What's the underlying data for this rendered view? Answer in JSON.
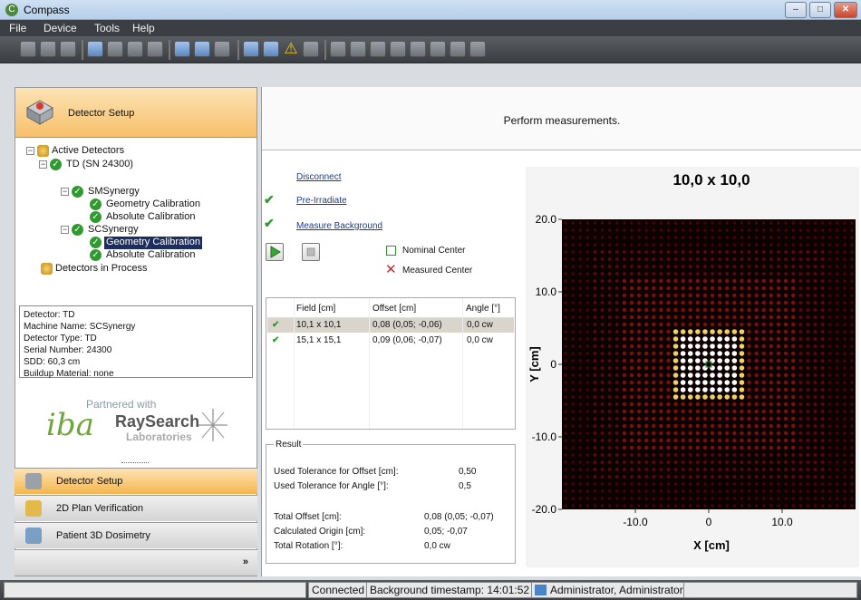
{
  "window": {
    "title": "Compass",
    "min": "–",
    "max": "□",
    "close": "✕"
  },
  "menu": [
    "File",
    "Device",
    "Tools",
    "Help"
  ],
  "left": {
    "header_label": "Detector Setup",
    "tree": {
      "active_detectors": "Active Detectors",
      "td": "TD (SN 24300)",
      "smsynergy": "SMSynergy",
      "sm_geom": "Geometry Calibration",
      "sm_abs": "Absolute Calibration",
      "scsynergy": "SCSynergy",
      "sc_geom": "Geometry Calibration",
      "sc_abs": "Absolute Calibration",
      "in_process": "Detectors in Process"
    },
    "info": [
      "Detector: TD",
      "Machine Name: SCSynergy",
      "Detector Type: TD",
      "Serial Number: 24300",
      "SDD: 60,3 cm",
      "Buildup Material: none"
    ],
    "partner": {
      "caption": "Partnered with",
      "iba": "iba",
      "ray": "RaySearch",
      "lab": "Laboratories"
    },
    "nav": [
      "Detector Setup",
      "2D Plan Verification",
      "Patient 3D Dosimetry"
    ],
    "more": "»"
  },
  "main": {
    "banner": "Perform measurements.",
    "actions": {
      "disconnect": "Disconnect",
      "preirradiate": "Pre-Irradiate",
      "background": "Measure Background"
    },
    "legend": {
      "nominal": "Nominal Center",
      "measured": "Measured Center"
    },
    "table": {
      "headers": [
        "Field [cm]",
        "Offset [cm]",
        "Angle [°]"
      ],
      "rows": [
        {
          "field": "10,1 x 10,1",
          "offset": "0,08 (0,05; -0,06)",
          "angle": "0,0 cw"
        },
        {
          "field": "15,1 x 15,1",
          "offset": "0,09 (0,06; -0,07)",
          "angle": "0,0 cw"
        }
      ]
    },
    "result": {
      "caption": "Result",
      "tol_offset_label": "Used Tolerance for Offset [cm]:",
      "tol_offset": "0,50",
      "tol_angle_label": "Used Tolerance for Angle [°]:",
      "tol_angle": "0,5",
      "total_offset_label": "Total Offset [cm]:",
      "total_offset": "0,08 (0,05; -0,07)",
      "origin_label": "Calculated Origin [cm]:",
      "origin": "0,05; -0,07",
      "rotation_label": "Total Rotation [°]:",
      "rotation": "0,0 cw"
    }
  },
  "chart_data": {
    "type": "heatmap",
    "title": "10,0 x 10,0",
    "xlabel": "X [cm]",
    "ylabel": "Y [cm]",
    "xticks": [
      "-10.0",
      "0",
      "10.0"
    ],
    "yticks": [
      "20.0",
      "10.0",
      "0",
      "-10.0",
      "-20.0"
    ],
    "xlim": [
      -20,
      20
    ],
    "ylim": [
      -20,
      20
    ],
    "field_size": [
      10,
      10
    ]
  },
  "status": {
    "connected": "Connected",
    "background": "Background timestamp: 14:01:52",
    "user": "Administrator, Administrator"
  },
  "colors": {
    "accent": "#f7c06b",
    "link": "#1a3c8a",
    "ok": "#2f9a2f"
  }
}
